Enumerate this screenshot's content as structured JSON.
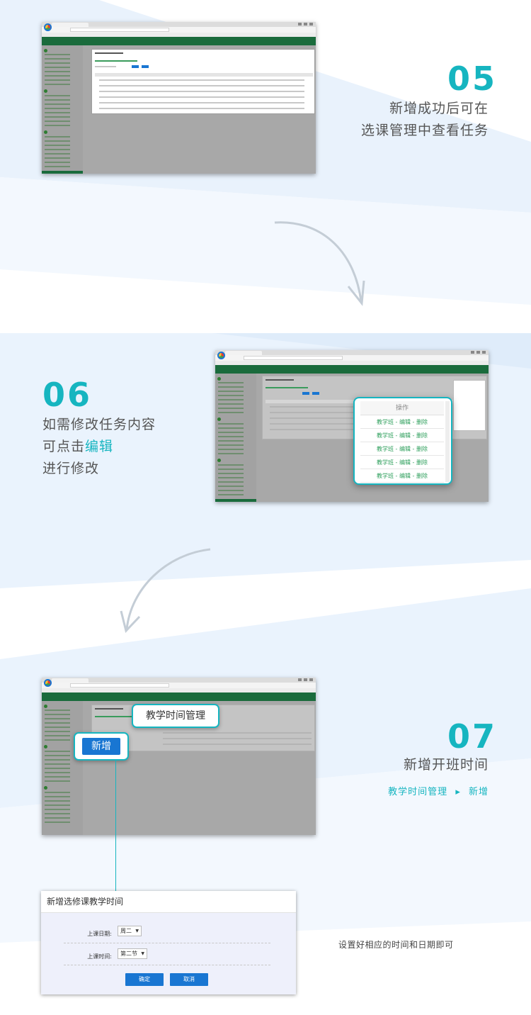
{
  "colors": {
    "accent": "#16b5c0",
    "primary_button": "#1976d2",
    "app_green": "#1a6b3c"
  },
  "step05": {
    "number": "05",
    "line1": "新增成功后可在",
    "line2": "选课管理中查看任务"
  },
  "step06": {
    "number": "06",
    "line1": "如需修改任务内容",
    "line2_prefix": "可点击",
    "line2_highlight": "编辑",
    "line3": "进行修改"
  },
  "step06_popup": {
    "header": "操作",
    "rows": [
      "教学班 - 编辑 - 删除",
      "教学班 - 编辑 - 删除",
      "教学班 - 编辑 - 删除",
      "教学班 - 编辑 - 删除",
      "教学班 - 编辑 - 删除"
    ]
  },
  "step07": {
    "number": "07",
    "title": "新增开班时间",
    "path_a": "教学时间管理",
    "path_sep": "▸",
    "path_b": "新增"
  },
  "step07_callouts": {
    "teaching_time": "教学时间管理",
    "new_button": "新增"
  },
  "dialog": {
    "title": "新增选修课教学时间",
    "date_label": "上课日期:",
    "date_value": "周二",
    "time_label": "上课时间:",
    "time_value": "第二节",
    "confirm": "确定",
    "cancel": "取消"
  },
  "note": "设置好相应的时间和日期即可"
}
